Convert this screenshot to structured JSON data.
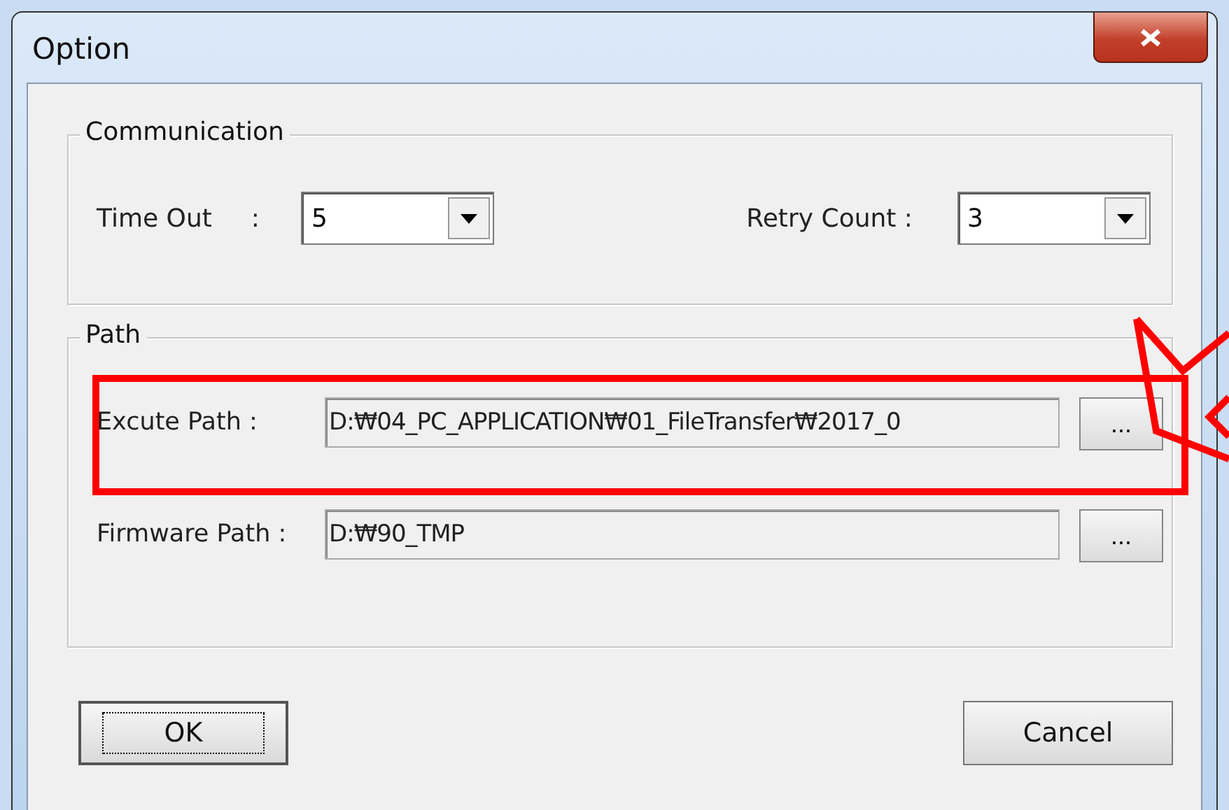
{
  "window": {
    "title": "Option"
  },
  "communication": {
    "title": "Communication",
    "fields": [
      {
        "label": "Time Out",
        "colon": ":",
        "value": "5"
      },
      {
        "label": "Retry Count :",
        "value": "3"
      }
    ]
  },
  "path": {
    "title": "Path",
    "rows": [
      {
        "label": "Excute Path :",
        "value": "D:₩04_PC_APPLICATION₩01_FileTransfer₩2017_0",
        "browse": "...",
        "highlighted": true
      },
      {
        "label": "Firmware Path :",
        "value": "D:₩90_TMP",
        "browse": "...",
        "highlighted": false
      }
    ]
  },
  "buttons": [
    {
      "label": "OK",
      "focused": true
    },
    {
      "label": "Cancel",
      "focused": false
    }
  ]
}
